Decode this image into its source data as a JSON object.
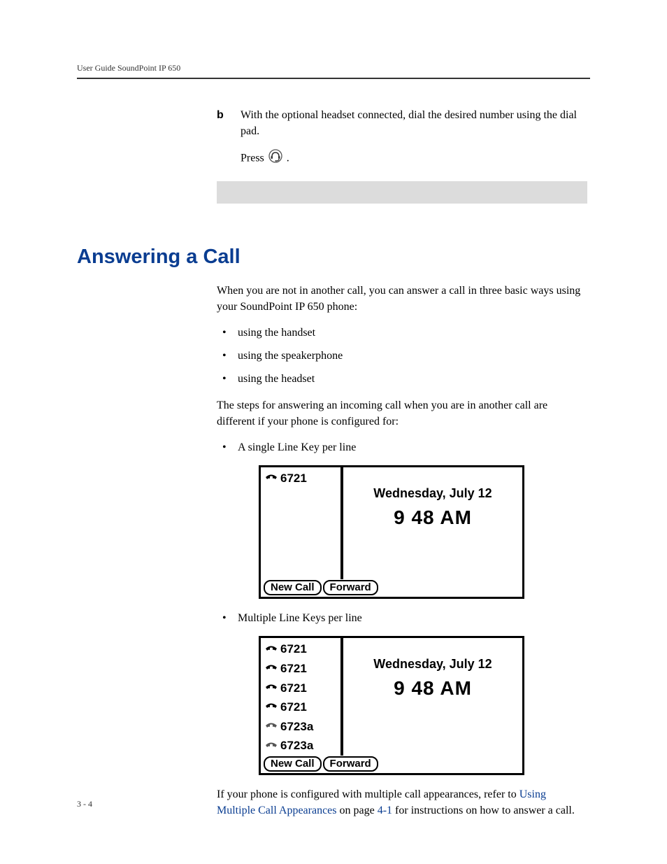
{
  "header": {
    "runningTitle": "User Guide SoundPoint IP 650"
  },
  "step_b": {
    "letter": "b",
    "text": "With the optional headset connected, dial the desired number using the dial pad.",
    "press_prefix": "Press ",
    "press_suffix": " ."
  },
  "section": {
    "heading": "Answering a Call",
    "intro": "When you are not in another call, you can answer a call in three basic ways using your SoundPoint IP 650 phone:",
    "ways": [
      "using the handset",
      "using the speakerphone",
      "using the headset"
    ],
    "para2": "The steps for answering an incoming call when you are in another call are different if your phone is configured for:",
    "config1": "A single Line Key per line",
    "config2": "Multiple Line Keys per line",
    "closing_prefix": "If your phone is configured with multiple call appearances, refer to ",
    "link1": "Using Multiple Call Appearances",
    "closing_mid": " on page ",
    "link2": "4-1",
    "closing_suffix": " for instructions on how to answer a call."
  },
  "screen1": {
    "line": "6721",
    "date": "Wednesday, July 12",
    "time": "9 48 AM",
    "softkeys": [
      "New Call",
      "Forward"
    ]
  },
  "screen2": {
    "lines": [
      "6721",
      "6721",
      "6721",
      "6721",
      "6723a",
      "6723a"
    ],
    "date": "Wednesday, July 12",
    "time": "9 48 AM",
    "softkeys": [
      "New Call",
      "Forward"
    ]
  },
  "footer": {
    "pageNumber": "3 - 4"
  }
}
